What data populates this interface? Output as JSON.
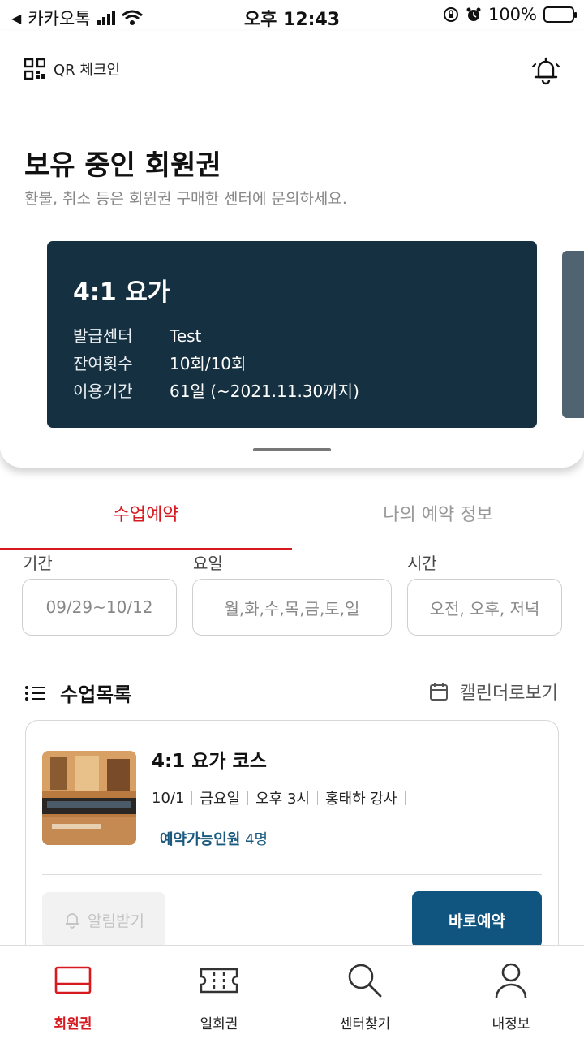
{
  "status_bar": {
    "back_app": "카카오톡",
    "time": "오후 12:43",
    "battery": "100%"
  },
  "header": {
    "qr_label": "QR 체크인"
  },
  "membership": {
    "title": "보유 중인 회원권",
    "subtitle": "환불, 취소 등은 회원권 구매한 센터에 문의하세요.",
    "card": {
      "name": "4:1 요가",
      "rows": [
        {
          "key": "발급센터",
          "value": "Test"
        },
        {
          "key": "잔여횟수",
          "value": "10회/10회"
        },
        {
          "key": "이용기간",
          "value": "61일 (~2021.11.30까지)"
        }
      ]
    }
  },
  "tabs": [
    {
      "label": "수업예약",
      "active": true
    },
    {
      "label": "나의 예약 정보",
      "active": false
    }
  ],
  "filters": {
    "period_label": "기간",
    "period_value": "09/29~10/12",
    "day_label": "요일",
    "day_value": "월,화,수,목,금,토,일",
    "time_label": "시간",
    "time_value": "오전, 오후, 저녁"
  },
  "class_list": {
    "title": "수업목록",
    "calendar_link": "캘린더로보기",
    "items": [
      {
        "title": "4:1 요가 코스",
        "date": "10/1",
        "weekday": "금요일",
        "time": "오후 3시",
        "instructor": "홍태하 강사",
        "avail_label": "예약가능인원",
        "avail_count": "4명",
        "notify_label": "알림받기",
        "reserve_label": "바로예약"
      }
    ]
  },
  "bottom_nav": [
    {
      "label": "회원권",
      "icon": "membership-icon",
      "active": true
    },
    {
      "label": "일회권",
      "icon": "ticket-icon",
      "active": false
    },
    {
      "label": "센터찾기",
      "icon": "search-icon",
      "active": false
    },
    {
      "label": "내정보",
      "icon": "person-icon",
      "active": false
    }
  ],
  "colors": {
    "accent_red": "#d71920",
    "card_navy": "#153040",
    "button_blue": "#0f5580"
  }
}
